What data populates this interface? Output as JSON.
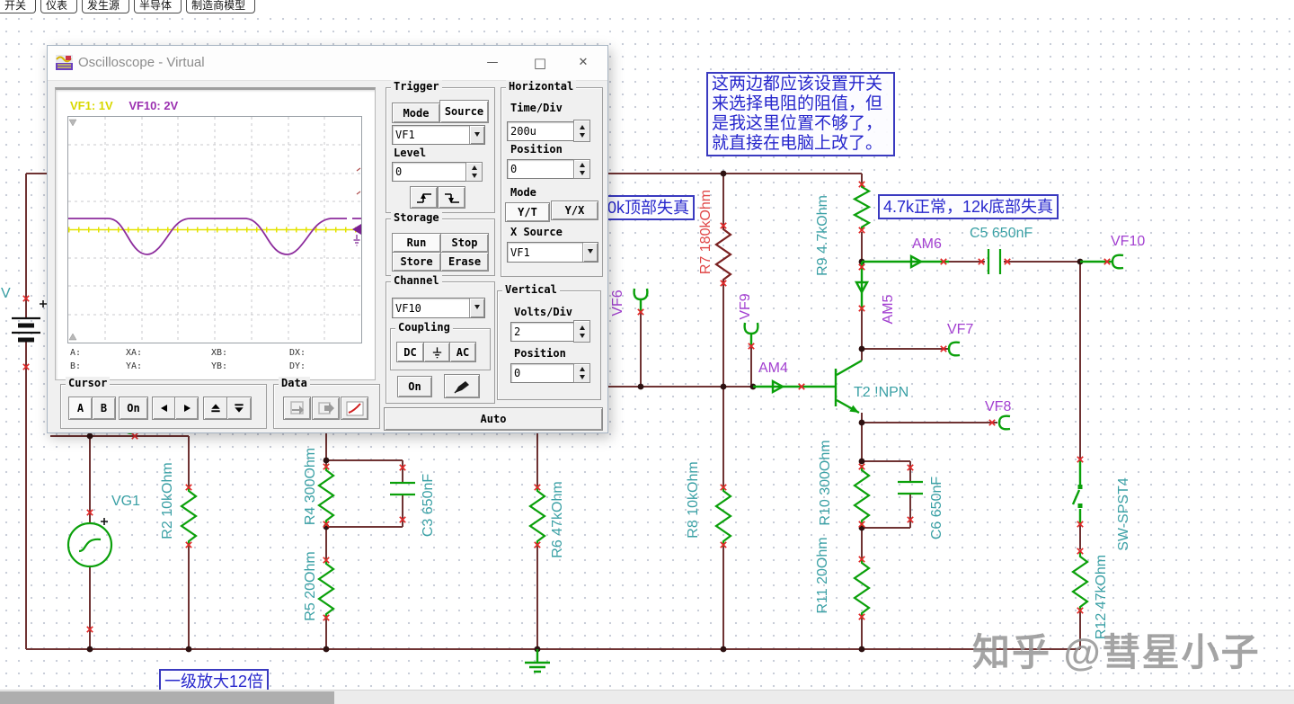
{
  "menu": {
    "tabs": [
      "开关",
      "仪表",
      "发生源",
      "半导体",
      "制造商模型"
    ]
  },
  "oscilloscope": {
    "title": "Oscilloscope - Virtual",
    "display": {
      "ch1_label": "VF1: 1V",
      "ch2_label": "VF10: 2V",
      "readout_row1": [
        "A:",
        "XA:",
        "XB:",
        "DX:"
      ],
      "readout_row2": [
        "B:",
        "YA:",
        "YB:",
        "DY:"
      ]
    },
    "trigger": {
      "title": "Trigger",
      "mode_btn": "Mode",
      "source_btn": "Source",
      "source_value": "VF1",
      "level_label": "Level",
      "level_value": "0"
    },
    "horizontal": {
      "title": "Horizontal",
      "time_div_label": "Time/Div",
      "time_div_value": "200u",
      "position_label": "Position",
      "position_value": "0",
      "mode_label": "Mode",
      "yt_btn": "Y/T",
      "yx_btn": "Y/X",
      "x_source_label": "X Source",
      "x_source_value": "VF1"
    },
    "storage": {
      "title": "Storage",
      "run_btn": "Run",
      "stop_btn": "Stop",
      "store_btn": "Store",
      "erase_btn": "Erase"
    },
    "channel": {
      "title": "Channel",
      "value": "VF10",
      "coupling_label": "Coupling",
      "dc_btn": "DC",
      "ac_btn": "AC",
      "on_btn": "On"
    },
    "vertical": {
      "title": "Vertical",
      "volts_div_label": "Volts/Div",
      "volts_div_value": "2",
      "position_label": "Position",
      "position_value": "0"
    },
    "cursor": {
      "title": "Cursor",
      "a_btn": "A",
      "b_btn": "B",
      "on_btn": "On"
    },
    "data": {
      "title": "Data"
    },
    "auto_btn": "Auto"
  },
  "schematic": {
    "battery_label": "V",
    "source_label": "VG1",
    "components": {
      "r2": "R2 10kOhm",
      "r4": "R4 300Ohm",
      "r5": "R5 20Ohm",
      "c3": "C3 650nF",
      "r6": "R6 47kOhm",
      "r7": "R7 180kOhm",
      "r8": "R8 10kOhm",
      "r9": "R9 4.7kOhm",
      "r10": "R10 300Ohm",
      "r11": "R11 20Ohm",
      "c5": "C5 650nF",
      "c6": "C6 650nF",
      "r12": "R12 47kOhm",
      "sw": "SW-SPST4",
      "t2": "T2 !NPN"
    },
    "probes": {
      "vf6": "VF6",
      "vf7": "VF7",
      "vf8": "VF8",
      "vf9": "VF9",
      "vf10": "VF10",
      "am4": "AM4",
      "am5": "AM5",
      "am6": "AM6"
    },
    "annotations": {
      "note_top": "这两边都应该设置开关\n来选择电阻的阻值，但\n是我这里位置不够了，\n就直接在电脑上改了。",
      "note_left": "0k顶部失真",
      "note_right": "4.7k正常，12k底部失真",
      "note_bottom": "一级放大12倍"
    }
  },
  "watermark": "知乎 @彗星小子"
}
